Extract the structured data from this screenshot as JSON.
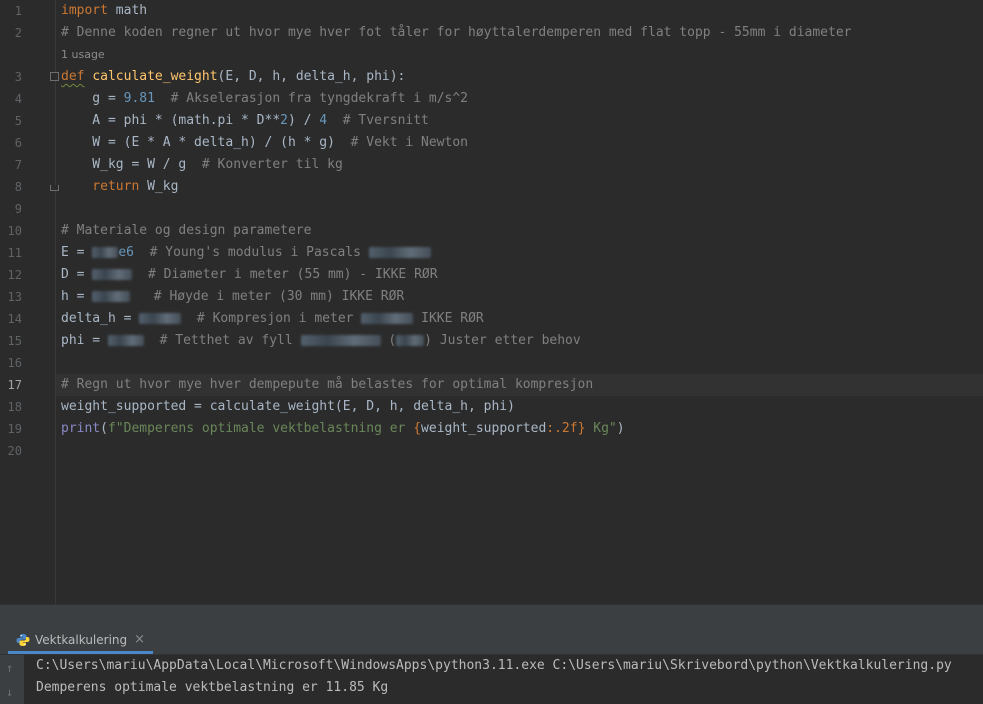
{
  "lines": {
    "l1": "1",
    "l2": "2",
    "l3": "3",
    "l4": "4",
    "l5": "5",
    "l6": "6",
    "l7": "7",
    "l8": "8",
    "l9": "9",
    "l10": "10",
    "l11": "11",
    "l12": "12",
    "l13": "13",
    "l14": "14",
    "l15": "15",
    "l16": "16",
    "l17": "17",
    "l18": "18",
    "l19": "19",
    "l20": "20"
  },
  "code": {
    "import_kw": "import",
    "import_mod": " math",
    "comment2": "# Denne koden regner ut hvor mye hver fot tåler for høyttalerdemperen med flat topp - 55mm i diameter",
    "usage_hint": "1 usage",
    "def_kw": "def",
    "func_name": "calculate_weight",
    "params": "(E, D, h, delta_h, phi):",
    "g_assign": "    g = ",
    "g_val": "9.81",
    "g_comment": "  # Akselerasjon fra tyngdekraft i m/s^2",
    "a_assign": "    A = phi * (math.pi * D**",
    "a_two": "2",
    "a_mid": ") / ",
    "a_four": "4",
    "a_comment": "  # Tversnitt",
    "w_line": "    W = (E * A * delta_h) / (h * g)",
    "w_comment": "  # Vekt i Newton",
    "wkg_line": "    W_kg = W / g",
    "wkg_comment": "  # Konverter til kg",
    "return_kw": "    return",
    "return_val": " W_kg",
    "comment10": "# Materiale og design parametere",
    "e_assign": "E = ",
    "e_suffix": "e6",
    "e_comment": "  # Young's modulus i Pascals ",
    "d_assign": "D = ",
    "d_comment": "  # Diameter i meter (55 mm) - IKKE RØR",
    "h_assign": "h = ",
    "h_comment": "   # Høyde i meter (30 mm) IKKE RØR",
    "dh_assign": "delta_h = ",
    "dh_comment_a": "  # Kompresjon i meter ",
    "dh_comment_b": " IKKE RØR",
    "phi_assign": "phi = ",
    "phi_comment_a": "  # Tetthet av fyll ",
    "phi_comment_b": " (",
    "phi_comment_c": ") Juster etter behov",
    "comment17": "# Regn ut hvor mye hver dempepute må belastes for optimal kompresjon",
    "call_line": "weight_supported = calculate_weight(E, D, h, delta_h, phi)",
    "print_fn": "print",
    "print_open": "(",
    "fstr_a": "f\"Demperens optimale vektbelastning er ",
    "fstr_expr_open": "{",
    "fstr_expr": "weight_supported",
    "fstr_fmt": ":.2f",
    "fstr_expr_close": "}",
    "fstr_b": " Kg\"",
    "print_close": ")"
  },
  "run": {
    "tab_label": "Vektkalkulering",
    "close_glyph": "×",
    "cmd_line": "C:\\Users\\mariu\\AppData\\Local\\Microsoft\\WindowsApps\\python3.11.exe C:\\Users\\mariu\\Skrivebord\\python\\Vektkalkulering.py",
    "output_line": "Demperens optimale vektbelastning er 11.85 Kg",
    "up_arrow": "↑",
    "down_arrow": "↓"
  }
}
